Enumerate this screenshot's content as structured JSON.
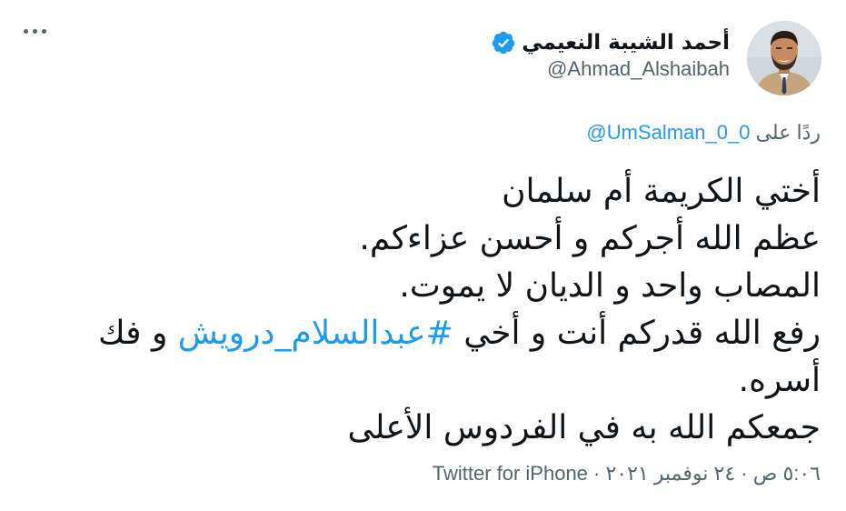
{
  "author": {
    "display_name": "أحمد الشيبة النعيمي",
    "handle": "@Ahmad_Alshaibah",
    "verified": true
  },
  "reply_context": {
    "prefix": "ردًا على",
    "mention": "@UmSalman_0_0"
  },
  "tweet": {
    "line1": "أختي الكريمة أم سلمان",
    "line2": "عظم الله أجركم و أحسن عزاءكم.",
    "line3": "المصاب واحد و الديان لا يموت.",
    "line4_before": "رفع الله قدركم أنت و أخي ",
    "hashtag": "#عبدالسلام_درويش",
    "line4_after": " و فك أسره.",
    "line5": "جمعكم الله به في الفردوس الأعلى"
  },
  "meta": {
    "time": "٥:٠٦ ص",
    "date": "٢٤ نوفمبر ٢٠٢١",
    "separator": "·",
    "source": "Twitter for iPhone"
  },
  "colors": {
    "link": "#1d9bf0",
    "secondary_text": "#536471",
    "primary_text": "#0f1419"
  },
  "icons": {
    "more": "more-horizontal-icon",
    "verified": "verified-badge-icon"
  }
}
